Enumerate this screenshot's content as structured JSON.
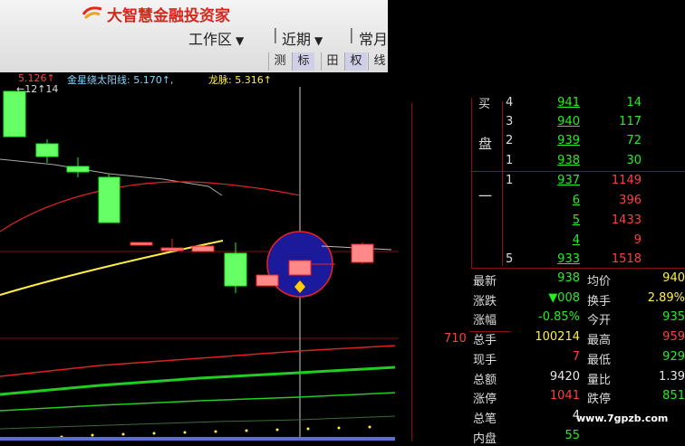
{
  "app": {
    "title": "大智慧金融投资家",
    "logo_icon": "swirl-logo-icon"
  },
  "menu": [
    {
      "label": "工作区",
      "caret": "▼"
    },
    {
      "label": "近期",
      "caret": "▼"
    },
    {
      "label": "常月",
      "caret": ""
    }
  ],
  "toolbar": [
    "测",
    "标",
    "田",
    "权",
    "线"
  ],
  "indicator": {
    "first_value": "5.126↑",
    "lunar_label": "金星绕太阳线: 5.170↑,",
    "dragon_label": "龙脉: 5.316↑",
    "marker_text": "←12↑14"
  },
  "price_axis_label": "710",
  "order_book": {
    "sell": [
      {
        "level": "4",
        "price": "941",
        "vol": "14"
      },
      {
        "level": "3",
        "price": "940",
        "vol": "117"
      },
      {
        "level": "2",
        "price": "939",
        "vol": "72"
      },
      {
        "level": "1",
        "price": "938",
        "vol": "30"
      }
    ],
    "buy": [
      {
        "level": "1",
        "price": "937",
        "vol": "1149"
      },
      {
        "level": "",
        "price": "6",
        "vol": "396"
      },
      {
        "level": "",
        "price": "5",
        "vol": "1433"
      },
      {
        "level": "",
        "price": "4",
        "vol": "9"
      },
      {
        "level": "5",
        "price": "933",
        "vol": "1518"
      }
    ],
    "sell_side_label_1": "买",
    "sell_side_label_2": "盘",
    "buy_side_label": "一"
  },
  "quote": {
    "rows": [
      {
        "l": "最新",
        "v": "938",
        "vc": "grn",
        "l2": "均价",
        "v2": "940",
        "v2c": "yel"
      },
      {
        "l": "涨跌",
        "v": "▼008",
        "vc": "grn",
        "l2": "换手",
        "v2": "2.89%",
        "v2c": "yel"
      },
      {
        "l": "涨幅",
        "v": "-0.85%",
        "vc": "grn",
        "l2": "今开",
        "v2": "935",
        "v2c": "grn"
      },
      {
        "l": "总手",
        "v": "100214",
        "vc": "yel",
        "l2": "最高",
        "v2": "959",
        "v2c": "red"
      },
      {
        "l": "现手",
        "v": "7",
        "vc": "red",
        "l2": "最低",
        "v2": "929",
        "v2c": "grn"
      },
      {
        "l": "总额",
        "v": "9420",
        "vc": "wht",
        "l2": "量比",
        "v2": "1.39",
        "v2c": "wht"
      },
      {
        "l": "涨停",
        "v": "1041",
        "vc": "red",
        "l2": "跌停",
        "v2": "851",
        "v2c": "grn"
      },
      {
        "l": "总笔",
        "v": "4",
        "vc": "wht",
        "l2": "",
        "v2": "",
        "v2c": "wht"
      },
      {
        "l": "内盘",
        "v": "55",
        "vc": "grn",
        "l2": "",
        "v2": "",
        "v2c": "wht"
      }
    ]
  },
  "watermark": "www.7gpzb.com",
  "colors": {
    "up": "#ff4040",
    "down": "#22ee22",
    "ma_yellow": "#ffee44",
    "ma_red": "#dd2222",
    "highlight": "#1a1a9a"
  }
}
